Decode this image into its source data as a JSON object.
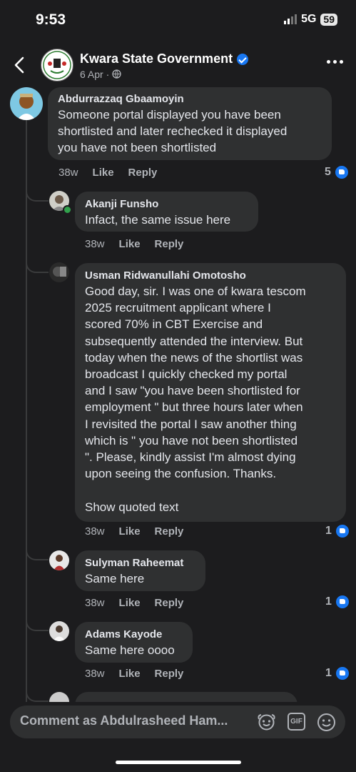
{
  "status": {
    "time": "9:53",
    "network": "5G",
    "battery": "59"
  },
  "post": {
    "page_name": "Kwara State Government",
    "date": "6 Apr",
    "date_sep": "·"
  },
  "comments": [
    {
      "author": "Abdurrazzaq Gbaamoyin",
      "lines": [
        "Someone portal displayed you have been",
        "shortlisted and later rechecked it displayed",
        "you have not been shortlisted"
      ],
      "time": "38w",
      "like": "Like",
      "reply": "Reply",
      "reactions": "5"
    },
    {
      "author": "Akanji Funsho",
      "lines": [
        "Infact, the same issue here"
      ],
      "time": "38w",
      "like": "Like",
      "reply": "Reply",
      "reactions": ""
    },
    {
      "author": "Usman Ridwanullahi Omotosho",
      "lines": [
        "Good day, sir. I was one of kwara tescom",
        "2025 recruitment applicant where I",
        "scored 70% in CBT Exercise and",
        "subsequently attended the interview. But",
        "today when the news of the shortlist was",
        "broadcast I quickly checked my portal",
        "and I saw \"you have been shortlisted for",
        "employment \" but three hours later when",
        "I revisited the portal I saw another thing",
        "which is \" you have not been shortlisted",
        "\". Please, kindly assist I'm almost dying",
        "upon seeing the confusion. Thanks."
      ],
      "show_quoted": "Show quoted text",
      "time": "38w",
      "like": "Like",
      "reply": "Reply",
      "reactions": "1"
    },
    {
      "author": "Sulyman Raheemat",
      "lines": [
        "Same here"
      ],
      "time": "38w",
      "like": "Like",
      "reply": "Reply",
      "reactions": "1"
    },
    {
      "author": "Adams Kayode",
      "lines": [
        "Same here oooo"
      ],
      "time": "38w",
      "like": "Like",
      "reply": "Reply",
      "reactions": "1"
    }
  ],
  "composer": {
    "placeholder": "Comment as Abdulrasheed Ham..."
  },
  "icons": {
    "back": "chevron-left-icon",
    "more": "more-horizontal-icon",
    "verified": "verified-badge-icon",
    "globe": "globe-icon",
    "like": "like-reaction-icon",
    "avatar_sticker": "avatar-sticker-icon",
    "gif": "gif-icon",
    "emoji": "emoji-icon"
  },
  "colors": {
    "background": "#1c1c1e",
    "bubble": "#2f3031",
    "accent": "#1877f2",
    "text": "#e4e6eb",
    "muted": "#b0b3b8"
  }
}
